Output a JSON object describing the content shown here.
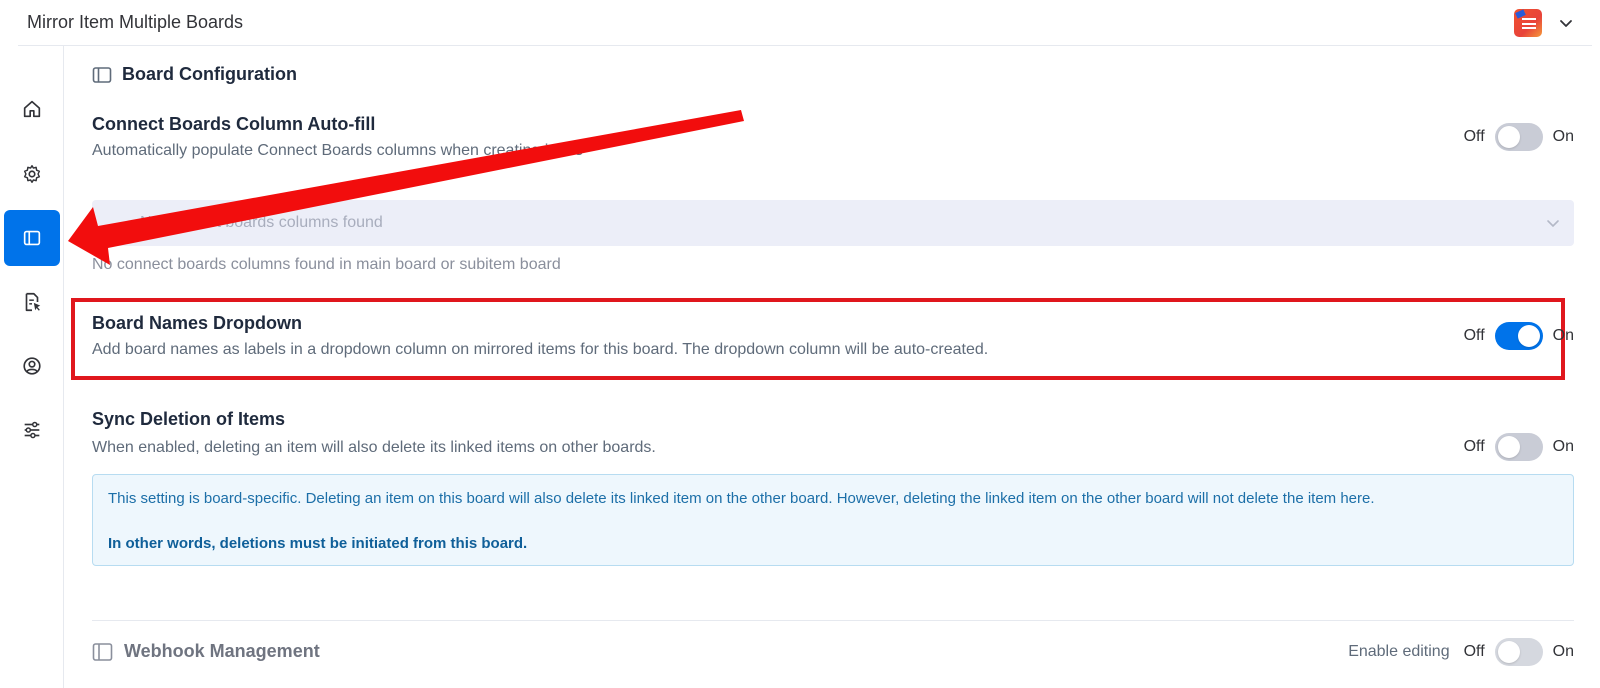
{
  "app": {
    "title": "Mirror Item Multiple Boards",
    "logo_icon": "app-logo-icon",
    "menu_icon": "chevron-down-icon"
  },
  "sidebar": {
    "items": [
      {
        "name": "home",
        "icon": "home-icon",
        "active": false
      },
      {
        "name": "settings",
        "icon": "gear-icon",
        "active": false
      },
      {
        "name": "board-configuration",
        "icon": "panel-icon",
        "active": true
      },
      {
        "name": "documents",
        "icon": "file-pointer-icon",
        "active": false
      },
      {
        "name": "account",
        "icon": "user-circle-icon",
        "active": false
      },
      {
        "name": "preferences",
        "icon": "sliders-icon",
        "active": false
      }
    ],
    "active_color": "#0073ea"
  },
  "section": {
    "title": "Board Configuration"
  },
  "settings": {
    "connect_boards": {
      "title": "Connect Boards Column Auto-fill",
      "description": "Automatically populate Connect Boards columns when creating items",
      "toggle": {
        "off_label": "Off",
        "on_label": "On",
        "state": "off"
      },
      "select_placeholder": "No connect boards columns found",
      "helper": "No connect boards columns found in main board or subitem board"
    },
    "board_names": {
      "title": "Board Names Dropdown",
      "description": "Add board names as labels in a dropdown column on mirrored items for this board. The dropdown column will be auto-created.",
      "toggle": {
        "off_label": "Off",
        "on_label": "On",
        "state": "on"
      }
    },
    "sync_deletion": {
      "title": "Sync Deletion of Items",
      "description": "When enabled, deleting an item will also delete its linked items on other boards.",
      "toggle": {
        "off_label": "Off",
        "on_label": "On",
        "state": "off"
      },
      "info_line1": "This setting is board-specific. Deleting an item on this board will also delete its linked item on the other board. However, deleting the linked item on the other board will not delete the item here.",
      "info_line2": "In other words, deletions must be initiated from this board."
    }
  },
  "webhook": {
    "title": "Webhook Management",
    "enable_editing": "Enable editing",
    "toggle": {
      "off_label": "Off",
      "on_label": "On",
      "state": "off"
    }
  },
  "annotations": {
    "highlight_color": "#e0171d",
    "arrow_color": "#f20d0d"
  }
}
